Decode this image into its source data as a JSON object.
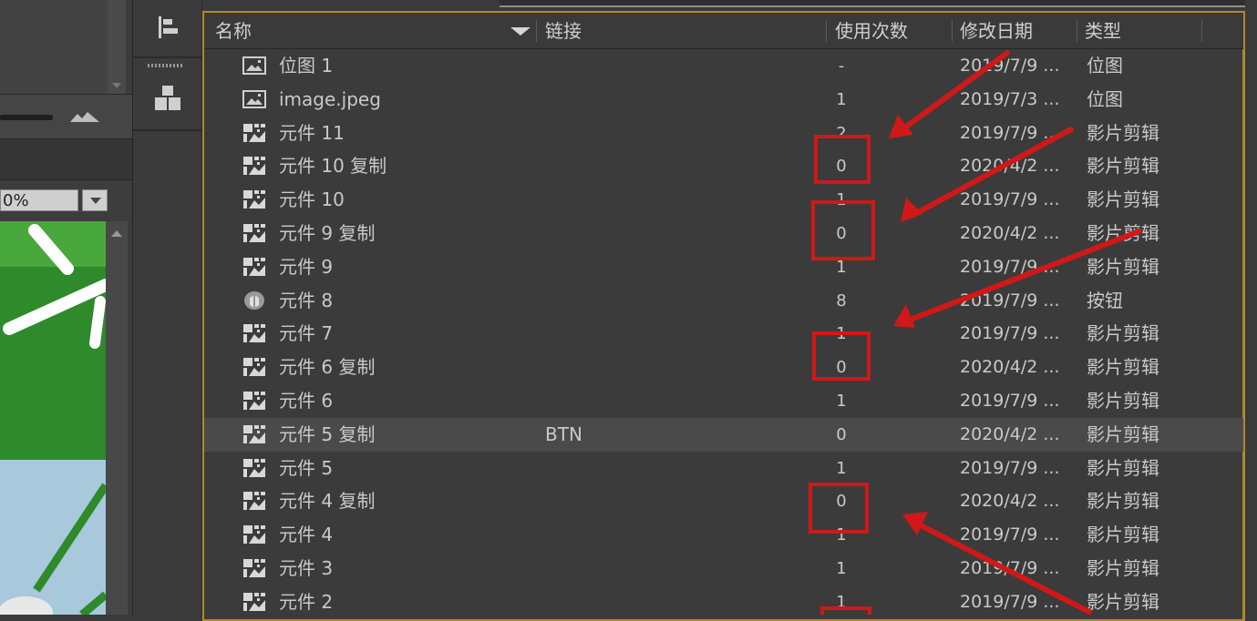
{
  "stage": {
    "zoom_value": "0%"
  },
  "library": {
    "columns": {
      "name": "名称",
      "linkage": "链接",
      "use_count": "使用次数",
      "modified": "修改日期",
      "type": "类型"
    },
    "items": [
      {
        "name": "位图 1",
        "linkage": "",
        "uses": "-",
        "date": "2019/7/9 ...",
        "type": "位图",
        "icon": "bitmap-icon"
      },
      {
        "name": "image.jpeg",
        "linkage": "",
        "uses": "1",
        "date": "2019/7/3 ...",
        "type": "位图",
        "icon": "bitmap-icon"
      },
      {
        "name": "元件 11",
        "linkage": "",
        "uses": "2",
        "date": "2019/7/9 ...",
        "type": "影片剪辑",
        "icon": "movieclip-icon"
      },
      {
        "name": "元件 10 复制",
        "linkage": "",
        "uses": "0",
        "date": "2020/4/2 ...",
        "type": "影片剪辑",
        "icon": "movieclip-icon"
      },
      {
        "name": "元件 10",
        "linkage": "",
        "uses": "1",
        "date": "2019/7/9 ...",
        "type": "影片剪辑",
        "icon": "movieclip-icon"
      },
      {
        "name": "元件 9 复制",
        "linkage": "",
        "uses": "0",
        "date": "2020/4/2 ...",
        "type": "影片剪辑",
        "icon": "movieclip-icon"
      },
      {
        "name": "元件 9",
        "linkage": "",
        "uses": "1",
        "date": "2019/7/9 ...",
        "type": "影片剪辑",
        "icon": "movieclip-icon"
      },
      {
        "name": "元件 8",
        "linkage": "",
        "uses": "8",
        "date": "2019/7/9 ...",
        "type": "按钮",
        "icon": "button-symbol-icon"
      },
      {
        "name": "元件 7",
        "linkage": "",
        "uses": "1",
        "date": "2019/7/9 ...",
        "type": "影片剪辑",
        "icon": "movieclip-icon"
      },
      {
        "name": "元件 6 复制",
        "linkage": "",
        "uses": "0",
        "date": "2020/4/2 ...",
        "type": "影片剪辑",
        "icon": "movieclip-icon"
      },
      {
        "name": "元件 6",
        "linkage": "",
        "uses": "1",
        "date": "2019/7/9 ...",
        "type": "影片剪辑",
        "icon": "movieclip-icon"
      },
      {
        "name": "元件 5 复制",
        "linkage": "BTN",
        "uses": "0",
        "date": "2020/4/2 ...",
        "type": "影片剪辑",
        "icon": "movieclip-icon",
        "selected": true
      },
      {
        "name": "元件 5",
        "linkage": "",
        "uses": "1",
        "date": "2019/7/9 ...",
        "type": "影片剪辑",
        "icon": "movieclip-icon"
      },
      {
        "name": "元件 4 复制",
        "linkage": "",
        "uses": "0",
        "date": "2020/4/2 ...",
        "type": "影片剪辑",
        "icon": "movieclip-icon"
      },
      {
        "name": "元件 4",
        "linkage": "",
        "uses": "1",
        "date": "2019/7/9 ...",
        "type": "影片剪辑",
        "icon": "movieclip-icon"
      },
      {
        "name": "元件 3",
        "linkage": "",
        "uses": "1",
        "date": "2019/7/9 ...",
        "type": "影片剪辑",
        "icon": "movieclip-icon"
      },
      {
        "name": "元件 2",
        "linkage": "",
        "uses": "1",
        "date": "2019/7/9 ...",
        "type": "影片剪辑",
        "icon": "movieclip-icon"
      }
    ]
  },
  "colors": {
    "panel_border": "#b08a2a",
    "annotation_red": "#d01818",
    "selected_row": "#4a4a4a"
  }
}
